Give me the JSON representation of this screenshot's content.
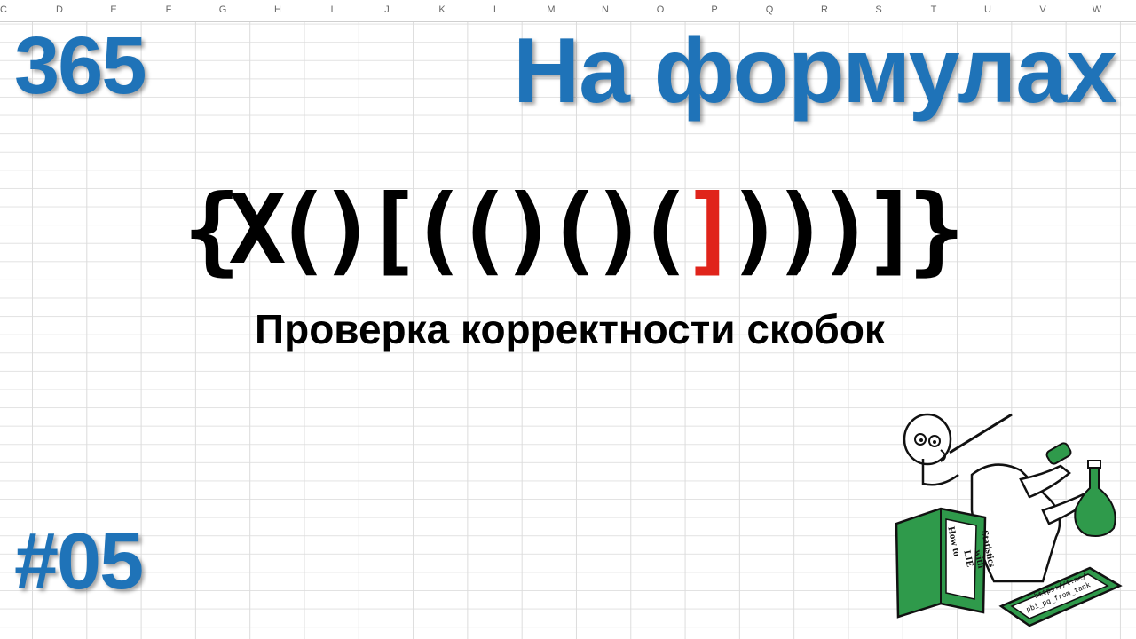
{
  "columns": [
    "C",
    "D",
    "E",
    "F",
    "G",
    "H",
    "I",
    "J",
    "K",
    "L",
    "M",
    "N",
    "O",
    "P",
    "Q",
    "R",
    "S",
    "T",
    "U",
    "V",
    "W"
  ],
  "series_label": "365",
  "heading": "На формулах",
  "bracket_expression": {
    "before": "{X()[(()()(",
    "error": "]",
    "after": ")))]}"
  },
  "subtitle": "Проверка корректности скобок",
  "episode": "#05",
  "illustration": {
    "book_title_lines": [
      "How to",
      "LIE",
      "with",
      "Statistics"
    ],
    "tablet_text_lines": [
      "https://t.me/",
      "pbi_pq_from_tank"
    ]
  },
  "colors": {
    "title_blue": "#1f73b8",
    "error_red": "#e0241b",
    "book_green": "#2f9a4b"
  }
}
